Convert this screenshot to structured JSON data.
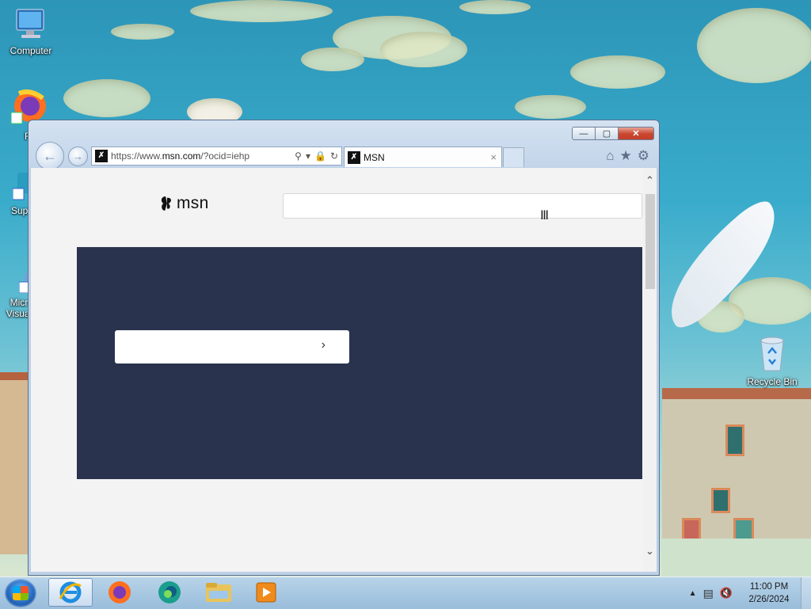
{
  "desktop": {
    "icons": [
      {
        "label": "Computer"
      },
      {
        "label": "Fir"
      },
      {
        "label": "Supe"
      },
      {
        "label": "Micr Visual"
      },
      {
        "label": "Recycle Bin"
      }
    ]
  },
  "browser": {
    "address": {
      "scheme": "https://www.",
      "host": "msn.com",
      "path": "/?ocid=iehp"
    },
    "tab": {
      "title": "MSN",
      "close": "×"
    },
    "window_buttons": {
      "minimize": "—",
      "maximize": "▢",
      "close": "✕"
    }
  },
  "page": {
    "logo_text": "msn",
    "search": {
      "value": "",
      "placeholder": ""
    },
    "cta": {
      "label": "",
      "chevron": "›"
    }
  },
  "taskbar": {
    "apps": [
      "internet-explorer",
      "firefox",
      "edge",
      "file-explorer",
      "media-player"
    ],
    "clock": {
      "time": "11:00 PM",
      "date": "2/26/2024"
    }
  }
}
